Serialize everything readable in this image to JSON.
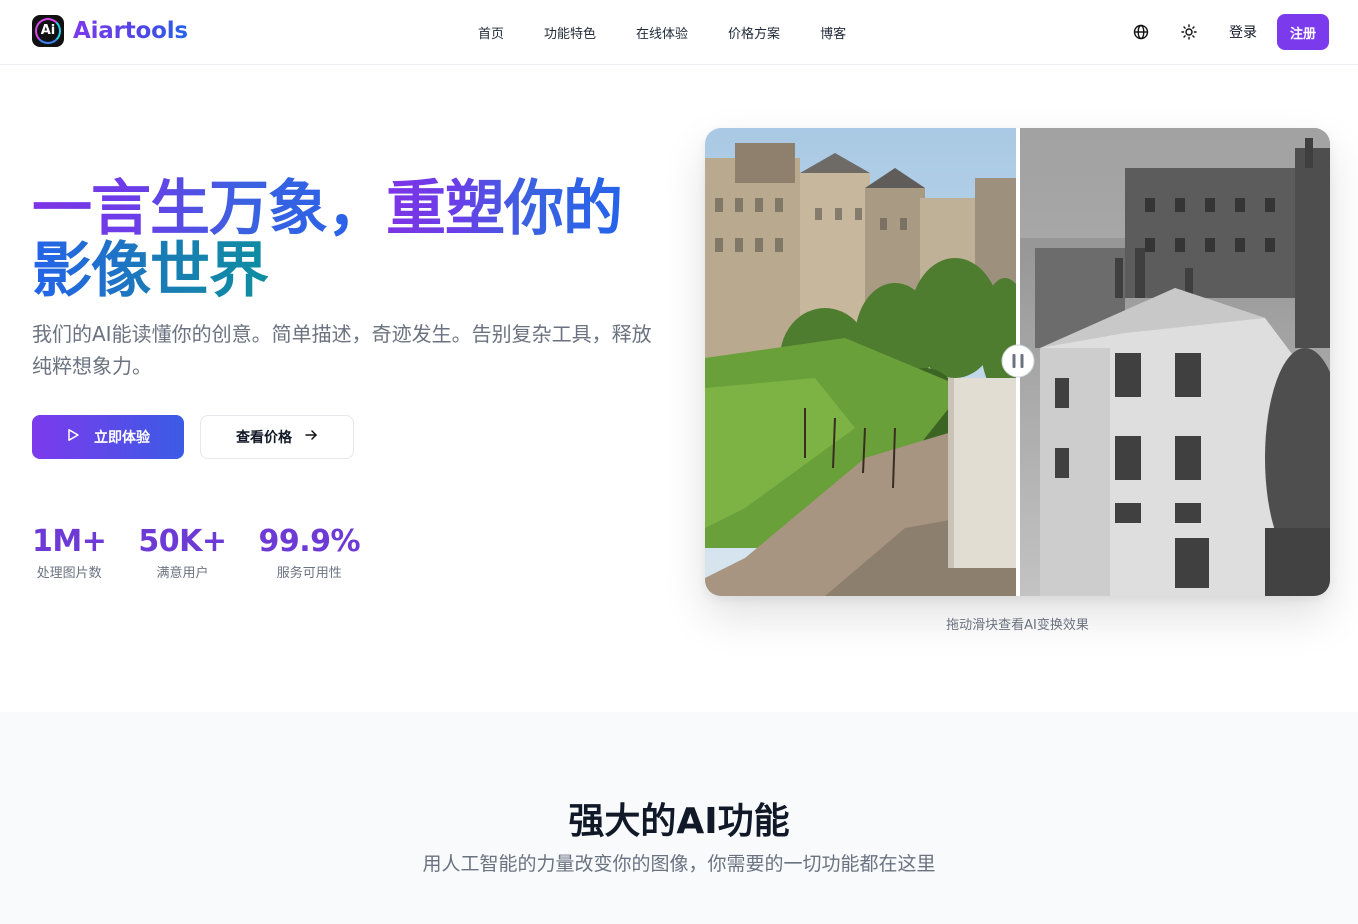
{
  "header": {
    "logo_badge": "Ai",
    "brand": "Aiartools",
    "nav": [
      "首页",
      "功能特色",
      "在线体验",
      "价格方案",
      "博客"
    ],
    "login": "登录",
    "signup": "注册",
    "icons": [
      "globe-icon",
      "sun-icon"
    ]
  },
  "hero": {
    "headline_line1a": "一言生万象，",
    "headline_line1b": "重塑你的",
    "headline_line2": "影像世界",
    "subtitle": "我们的AI能读懂你的创意。简单描述，奇迹发生。告别复杂工具，释放纯粹想象力。",
    "primary_button": "立即体验",
    "secondary_button": "查看价格",
    "stats": [
      {
        "value": "1M+",
        "label": "处理图片数"
      },
      {
        "value": "50K+",
        "label": "满意用户"
      },
      {
        "value": "99.9%",
        "label": "服务可用性"
      }
    ]
  },
  "compare": {
    "caption": "拖动滑块查看AI变换效果",
    "slider_position": 0.5
  },
  "features": {
    "title": "强大的AI功能",
    "subtitle": "用人工智能的力量改变你的图像，你需要的一切功能都在这里"
  },
  "colors": {
    "accent": "#7c3aed",
    "blue": "#2563eb",
    "muted": "#6b7280"
  }
}
